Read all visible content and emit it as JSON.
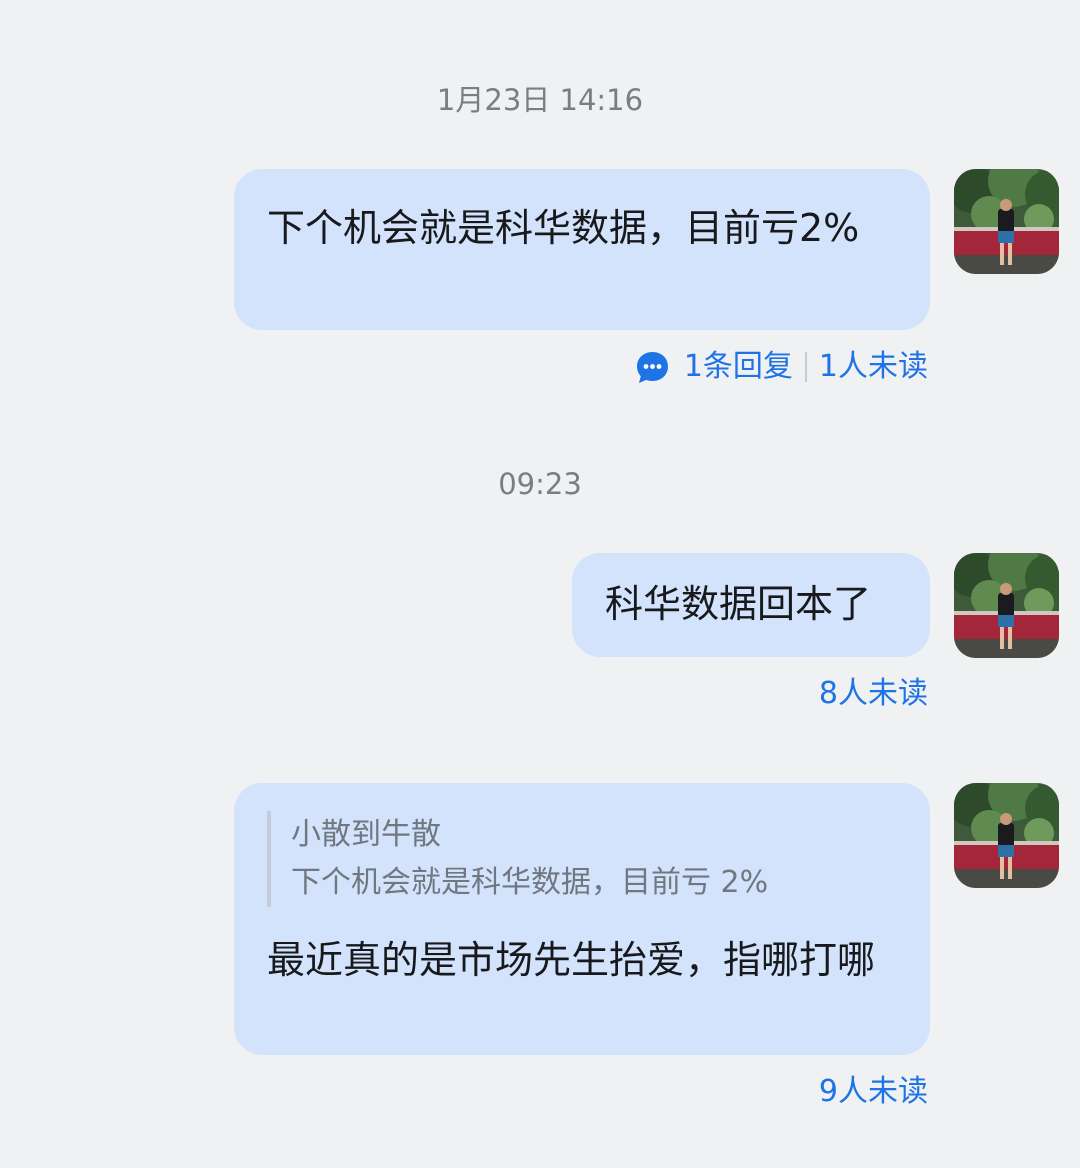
{
  "colors": {
    "background": "#f0f1f3",
    "bubble": "#d4e3fc",
    "accent": "#1e74e6",
    "timestamp": "#7a7d82"
  },
  "timestamps": [
    "1月23日 14:16",
    "09:23"
  ],
  "messages": [
    {
      "text": "下个机会就是科华数据，目前亏2%",
      "reply_count_label": "1条回复",
      "unread_label": "1人未读",
      "icon": "chat-bubble-icon"
    },
    {
      "text": "科华数据回本了",
      "unread_label": "8人未读"
    },
    {
      "quote": {
        "author": "小散到牛散",
        "text": "下个机会就是科华数据，目前亏 2%"
      },
      "text": "最近真的是市场先生抬爱，指哪打哪",
      "unread_label": "9人未读"
    }
  ]
}
